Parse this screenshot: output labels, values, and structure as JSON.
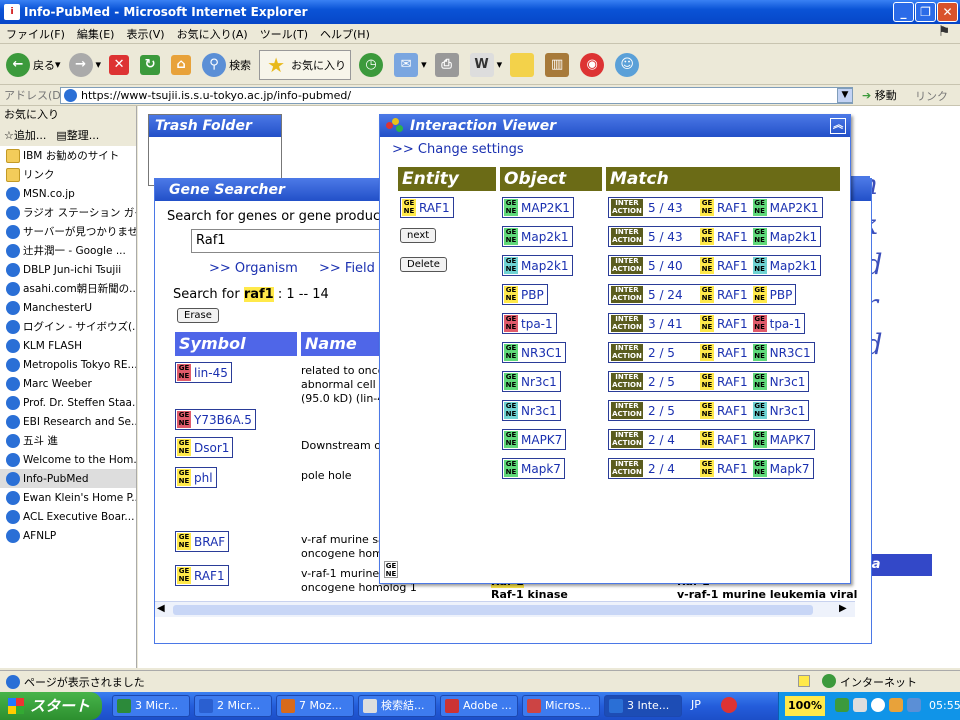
{
  "window": {
    "title": "Info-PubMed - Microsoft Internet Explorer"
  },
  "menu": [
    "ファイル(F)",
    "編集(E)",
    "表示(V)",
    "お気に入り(A)",
    "ツール(T)",
    "ヘルプ(H)"
  ],
  "toolbar": {
    "back": "戻る",
    "search": "検索",
    "favorites": "お気に入り"
  },
  "address": {
    "label": "アドレス(D)",
    "url": "https://www-tsujii.is.s.u-tokyo.ac.jp/info-pubmed/",
    "go": "移動",
    "links": "リンク"
  },
  "favorites": {
    "title": "お気に入り",
    "add": "追加...",
    "organize": "整理...",
    "items": [
      {
        "label": "IBM お勧めのサイト",
        "type": "folder"
      },
      {
        "label": "リンク",
        "type": "folder"
      },
      {
        "label": "MSN.co.jp",
        "type": "page"
      },
      {
        "label": "ラジオ ステーション ガイ...",
        "type": "page"
      },
      {
        "label": "サーバーが見つかりませ...",
        "type": "page"
      },
      {
        "label": "辻井潤一 - Google ...",
        "type": "page"
      },
      {
        "label": "DBLP Jun-ichi Tsujii",
        "type": "page"
      },
      {
        "label": "asahi.com朝日新聞の...",
        "type": "page"
      },
      {
        "label": "ManchesterU",
        "type": "page"
      },
      {
        "label": "ログイン - サイボウズ(...",
        "type": "page"
      },
      {
        "label": "KLM FLASH",
        "type": "page"
      },
      {
        "label": "Metropolis Tokyo RE...",
        "type": "page"
      },
      {
        "label": "Marc Weeber",
        "type": "page"
      },
      {
        "label": "Prof. Dr. Steffen Staa...",
        "type": "page"
      },
      {
        "label": "EBI Research and Se...",
        "type": "page"
      },
      {
        "label": "五斗 進",
        "type": "page"
      },
      {
        "label": "Welcome to the Hom...",
        "type": "page"
      },
      {
        "label": "Info-PubMed",
        "type": "page"
      },
      {
        "label": "Ewan Klein's Home P...",
        "type": "page"
      },
      {
        "label": "ACL Executive Boar...",
        "type": "page"
      },
      {
        "label": "AFNLP",
        "type": "page"
      }
    ]
  },
  "trash": {
    "title": "Trash Folder"
  },
  "ghost_text": [
    "on",
    "rk",
    "ed",
    "er",
    "ed"
  ],
  "gene_searcher": {
    "title": "Gene Searcher",
    "prompt": "Search for genes or gene produc",
    "query": "Raf1",
    "organism_link": ">> Organism",
    "field_link": ">> Field",
    "result_prefix": "Search for",
    "result_term": "raf1",
    "result_suffix": ": 1 -- 14",
    "erase": "Erase",
    "headers": {
      "symbol": "Symbol",
      "name": "Name"
    },
    "rows": [
      {
        "symbol": "lin-45",
        "color": "red",
        "name": "related to onco\nabnormal cell l\n(95.0 kD) (lin-4"
      },
      {
        "symbol": "Y73B6A.5",
        "color": "red",
        "name": ""
      },
      {
        "symbol": "Dsor1",
        "color": "yellow",
        "name": "Downstream o"
      },
      {
        "symbol": "phl",
        "color": "yellow",
        "name": "pole hole"
      },
      {
        "symbol": "BRAF",
        "color": "yellow",
        "name": "v-raf murine sa\noncogene hom"
      },
      {
        "symbol": "RAF1",
        "color": "yellow",
        "name": "v-raf-1 murine\noncogene homolog 1"
      }
    ],
    "below_rows": [
      "Raf-1",
      "Raf-1 kinase",
      "Raf-1",
      "v-raf-1 murine leukemia viral"
    ]
  },
  "interaction_viewer": {
    "title": "Interaction Viewer",
    "settings_link": ">> Change settings",
    "headers": {
      "entity": "Entity",
      "object": "Object",
      "match": "Match"
    },
    "entity": {
      "label": "RAF1",
      "color": "yellow"
    },
    "next": "next",
    "delete": "Delete",
    "rows": [
      {
        "object": "MAP2K1",
        "color": "green",
        "count": "5 / 43",
        "subject": "RAF1",
        "target": "MAP2K1"
      },
      {
        "object": "Map2k1",
        "color": "green",
        "count": "5 / 43",
        "subject": "RAF1",
        "target": "Map2k1"
      },
      {
        "object": "Map2k1",
        "color": "cyan",
        "count": "5 / 40",
        "subject": "RAF1",
        "target": "Map2k1"
      },
      {
        "object": "PBP",
        "color": "yellow",
        "count": "5 / 24",
        "subject": "RAF1",
        "target": "PBP"
      },
      {
        "object": "tpa-1",
        "color": "red",
        "count": "3 / 41",
        "subject": "RAF1",
        "target": "tpa-1"
      },
      {
        "object": "NR3C1",
        "color": "green",
        "count": "2 / 5",
        "subject": "RAF1",
        "target": "NR3C1"
      },
      {
        "object": "Nr3c1",
        "color": "green",
        "count": "2 / 5",
        "subject": "RAF1",
        "target": "Nr3c1"
      },
      {
        "object": "Nr3c1",
        "color": "cyan",
        "count": "2 / 5",
        "subject": "RAF1",
        "target": "Nr3c1"
      },
      {
        "object": "MAPK7",
        "color": "green",
        "count": "2 / 4",
        "subject": "RAF1",
        "target": "MAPK7"
      },
      {
        "object": "Mapk7",
        "color": "green",
        "count": "2 / 4",
        "subject": "RAF1",
        "target": "Mapk7"
      }
    ]
  },
  "gene_tag": {
    "line1": "GE",
    "line2": "NE"
  },
  "inter_tag": {
    "line1": "INTER",
    "line2": "ACTION"
  },
  "side_label": "sa",
  "status": {
    "text": "ページが表示されました",
    "zone": "インターネット"
  },
  "taskbar": {
    "start": "スタート",
    "tasks": [
      "3 Micr...",
      "2 Micr...",
      "7 Moz...",
      "検索結...",
      "Adobe ...",
      "Micros...",
      "3 Inte..."
    ],
    "lang": "JP",
    "zoom": "100%",
    "time": "05:55"
  },
  "colors": {
    "gene_yellow": "#ffe94a",
    "gene_green": "#5fd97a",
    "gene_red": "#e05a6a",
    "gene_cyan": "#6fd3d3",
    "olive": "#6b6b16",
    "xp_blue": "#0a53d6"
  }
}
